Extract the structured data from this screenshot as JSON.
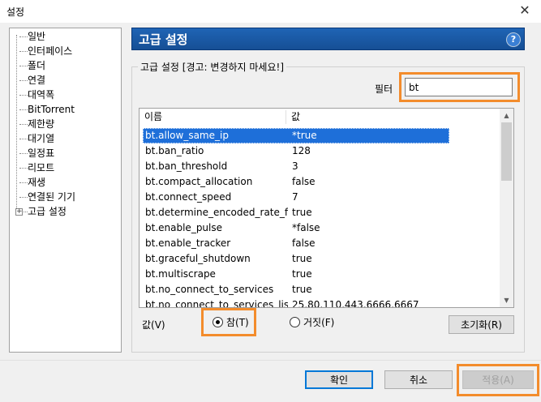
{
  "window": {
    "title": "설정",
    "close_glyph": "✕"
  },
  "tree": {
    "items": [
      "일반",
      "인터페이스",
      "폴더",
      "연결",
      "대역폭",
      "BitTorrent",
      "제한량",
      "대기열",
      "일정표",
      "리모트",
      "재생",
      "연결된 기기",
      "고급 설정"
    ],
    "expander_glyph": "+"
  },
  "header": {
    "title": "고급 설정",
    "help_glyph": "?"
  },
  "group": {
    "legend": "고급 설정 [경고: 변경하지 마세요!]"
  },
  "filter": {
    "label": "필터",
    "value": "bt"
  },
  "list": {
    "columns": [
      "이름",
      "값"
    ],
    "rows": [
      [
        "bt.allow_same_ip",
        "*true"
      ],
      [
        "bt.ban_ratio",
        "128"
      ],
      [
        "bt.ban_threshold",
        "3"
      ],
      [
        "bt.compact_allocation",
        "false"
      ],
      [
        "bt.connect_speed",
        "7"
      ],
      [
        "bt.determine_encoded_rate_fo...",
        "true"
      ],
      [
        "bt.enable_pulse",
        "*false"
      ],
      [
        "bt.enable_tracker",
        "false"
      ],
      [
        "bt.graceful_shutdown",
        "true"
      ],
      [
        "bt.multiscrape",
        "true"
      ],
      [
        "bt.no_connect_to_services",
        "true"
      ],
      [
        "bt.no_connect_to_services_list",
        "25,80,110,443,6666,6667"
      ]
    ]
  },
  "value_editor": {
    "label": "값(V)",
    "true_label": "참(T)",
    "false_label": "거짓(F)",
    "reset_label": "초기화(R)"
  },
  "buttons": {
    "ok": "확인",
    "cancel": "취소",
    "apply": "적용(A)"
  },
  "colors": {
    "accent": "#1f64b5",
    "selection": "#1e6fd9",
    "highlight": "#f38c2c"
  }
}
